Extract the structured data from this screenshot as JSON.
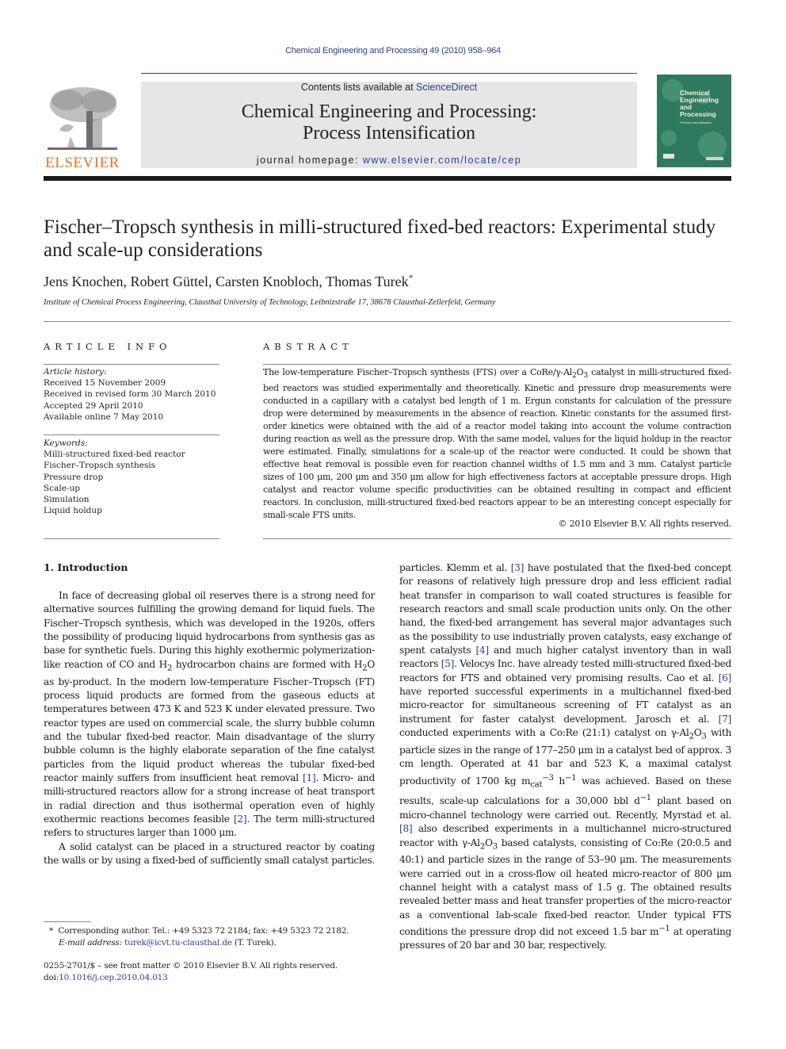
{
  "running_head": "Chemical Engineering and Processing 49 (2010) 958–964",
  "banner": {
    "contents_prefix": "Contents lists available at ",
    "contents_link": "ScienceDirect",
    "journal_title_line1": "Chemical Engineering and Processing:",
    "journal_title_line2": "Process Intensification",
    "homepage_prefix": "journal homepage: ",
    "homepage_link": "www.elsevier.com/locate/cep",
    "publisher": "ELSEVIER",
    "cover_title": [
      "Chemical",
      "Engineering",
      "and",
      "Processing"
    ],
    "cover_subtitle": "Process Intensification"
  },
  "article": {
    "title": "Fischer–Tropsch synthesis in milli-structured fixed-bed reactors: Experimental study and scale-up considerations",
    "authors": "Jens Knochen, Robert Güttel, Carsten Knobloch, Thomas Turek",
    "corresponding_marker": "*",
    "affiliation": "Institute of Chemical Process Engineering, Clausthal University of Technology, Leibnizstraße 17, 38678 Clausthal-Zellerfeld, Germany"
  },
  "article_info": {
    "heading": "ARTICLE INFO",
    "history_label": "Article history:",
    "history": [
      "Received 15 November 2009",
      "Received in revised form 30 March 2010",
      "Accepted 29 April 2010",
      "Available online 7 May 2010"
    ],
    "keywords_label": "Keywords:",
    "keywords": [
      "Milli-structured fixed-bed reactor",
      "Fischer–Tropsch synthesis",
      "Pressure drop",
      "Scale-up",
      "Simulation",
      "Liquid holdup"
    ]
  },
  "abstract": {
    "heading": "ABSTRACT",
    "text_1": "The low-temperature Fischer–Tropsch synthesis (FTS) over a CoRe/γ-Al",
    "sub_2": "2",
    "text_2": "O",
    "sub_3": "3",
    "text_3": " catalyst in milli-structured fixed-bed reactors was studied experimentally and theoretically. Kinetic and pressure drop measurements were conducted in a capillary with a catalyst bed length of 1 m. Ergun constants for calculation of the pressure drop were determined by measurements in the absence of reaction. Kinetic constants for the assumed first-order kinetics were obtained with the aid of a reactor model taking into account the volume contraction during reaction as well as the pressure drop. With the same model, values for the liquid holdup in the reactor were estimated. Finally, simulations for a scale-up of the reactor were conducted. It could be shown that effective heat removal is possible even for reaction channel widths of 1.5 mm and 3 mm. Catalyst particle sizes of 100 μm, 200 μm and 350 μm allow for high effectiveness factors at acceptable pressure drops. High catalyst and reactor volume specific productivities can be obtained resulting in compact and efficient reactors. In conclusion, milli-structured fixed-bed reactors appear to be an interesting concept especially for small-scale FTS units.",
    "copyright": "© 2010 Elsevier B.V. All rights reserved."
  },
  "introduction": {
    "heading": "1.  Introduction",
    "p1_a": "In face of decreasing global oil reserves there is a strong need for alternative sources fulfilling the growing demand for liquid fuels. The Fischer–Tropsch synthesis, which was developed in the 1920s, offers the possibility of producing liquid hydrocarbons from synthesis gas as base for synthetic fuels. During this highly exothermic polymerization-like reaction of CO and H",
    "p1_sub1": "2",
    "p1_b": " hydrocarbon chains are formed with H",
    "p1_sub2": "2",
    "p1_c": "O as by-product. In the modern low-temperature Fischer–Tropsch (FT) process liquid products are formed from the gaseous educts at temperatures between 473 K and 523 K under elevated pressure. Two reactor types are used on commercial scale, the slurry bubble column and the tubular fixed-bed reactor. Main disadvantage of the slurry bubble column is the highly elaborate separation of the fine catalyst particles from the liquid product whereas the tubular fixed-bed reactor mainly suffers from insufficient heat removal ",
    "ref1": "[1]",
    "p1_d": ". Micro- and milli-structured reactors allow for a strong increase of heat transport in radial direction and thus isothermal operation even of highly exothermic reactions becomes feasible ",
    "ref2": "[2]",
    "p1_e": ". The term milli-structured refers to structures larger than 1000 μm.",
    "p2_a": "A solid catalyst can be placed in a structured reactor by coating the walls or by using a fixed-bed of sufficiently small catalyst particles. Klemm et al. ",
    "ref3": "[3]",
    "p2_b": " have postulated that the fixed-bed concept for reasons of relatively high pressure drop and less efficient radial heat transfer in comparison to wall coated structures is feasible for research reactors and small scale production units only. On the other hand, the fixed-bed arrangement has several major advantages such as the possibility to use industrially proven catalysts, easy exchange of spent catalysts ",
    "ref4": "[4]",
    "p2_c": " and much higher catalyst inventory than in wall reactors ",
    "ref5": "[5]",
    "p2_d": ". Velocys Inc. have already tested milli-structured fixed-bed reactors for FTS and obtained very promising results. Cao et al. ",
    "ref6": "[6]",
    "p2_e": " have reported successful experiments in a multichannel fixed-bed micro-reactor for simultaneous screening of FT catalyst as an instrument for faster catalyst development. Jarosch et al. ",
    "ref7": "[7]",
    "p2_f": " conducted experiments with a Co:Re (21:1) catalyst on γ-Al",
    "p2_sub1": "2",
    "p2_f2": "O",
    "p2_sub2": "3",
    "p2_g": " with particle sizes in the range of 177–250 μm in a catalyst bed of approx. 3 cm length. Operated at 41 bar and 523 K, a maximal catalyst productivity of 1700 kg m",
    "p2_sub_cat": "cat",
    "p2_sup_m3": "−3",
    "p2_h": " h",
    "p2_sup_h": "−1",
    "p2_i": " was achieved. Based on these results, scale-up calculations for a 30,000 bbl d",
    "p2_sup_d": "−1",
    "p2_j": " plant based on micro-channel technology were carried out. Recently, Myrstad et al. ",
    "ref8": "[8]",
    "p2_k": " also described experiments in a multichannel micro-structured reactor with γ-Al",
    "p2_sub3": "2",
    "p2_k2": "O",
    "p2_sub4": "3",
    "p2_l": " based catalysts, consisting of Co:Re (20:0.5 and 40:1) and particle sizes in the range of 53–90 μm. The measurements were carried out in a cross-flow oil heated micro-reactor of 800 μm channel height with a catalyst mass of 1.5 g. The obtained results revealed better mass and heat transfer properties of the micro-reactor as a conventional lab-scale fixed-bed reactor. Under typical FTS conditions the pressure drop did not exceed 1.5 bar m",
    "p2_sup_m1": "−1",
    "p2_m": " at operating pressures of 20 bar and 30 bar, respectively."
  },
  "footnotes": {
    "corresponding_marker": "*",
    "corresponding": "Corresponding author. Tel.: +49 5323 72 2184; fax: +49 5323 72 2182.",
    "email_label": "E-mail address:",
    "email": "turek@icvt.tu-clausthal.de",
    "email_suffix": " (T. Turek).",
    "front_matter": "0255-2701/$ – see front matter © 2010 Elsevier B.V. All rights reserved.",
    "doi_prefix": "doi:",
    "doi": "10.1016/j.cep.2010.04.013"
  },
  "colors": {
    "link_blue": "#2a3f8f",
    "elsevier_orange": "#e87722",
    "cover_green": "#2f7a5e",
    "banner_gray": "#e6e6e6"
  }
}
